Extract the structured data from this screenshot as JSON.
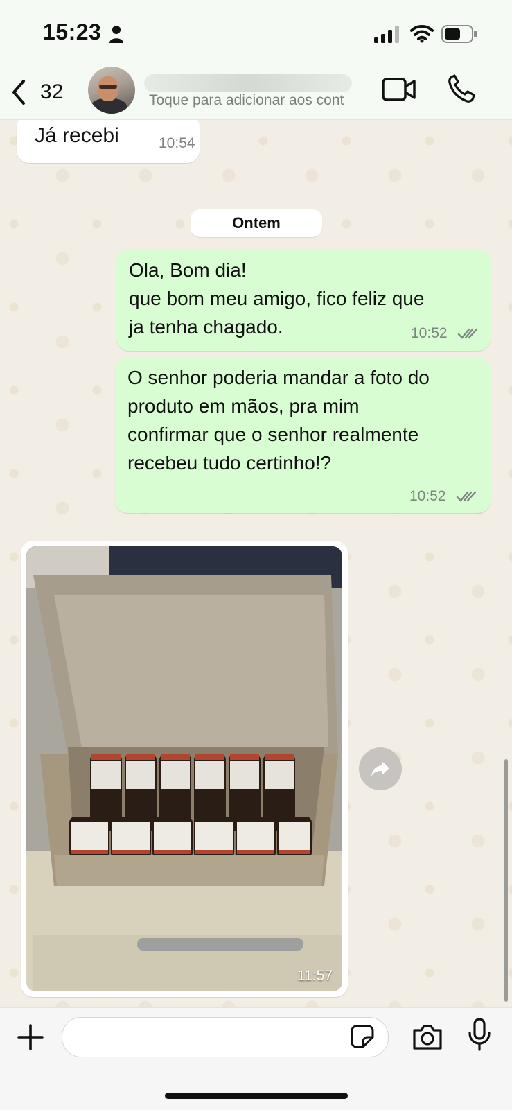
{
  "status_bar": {
    "time": "15:23",
    "icons": [
      "person-icon",
      "signal-icon",
      "wifi-icon",
      "battery-icon"
    ]
  },
  "header": {
    "back_count": "32",
    "contact_subtitle": "Toque para adicionar aos cont",
    "icons": [
      "chevron-left-icon",
      "avatar",
      "video-call-icon",
      "phone-icon"
    ]
  },
  "chat": {
    "messages": [
      {
        "direction": "in",
        "text": "Já recebi",
        "time": "10:54"
      },
      {
        "direction": "out",
        "text": "Ola, Bom dia!\nque bom meu amigo, fico feliz que\nja tenha chagado.",
        "time": "10:52",
        "status": "read"
      },
      {
        "direction": "out",
        "text": "O senhor poderia mandar a foto do\nproduto em mãos, pra mim\nconfirmar que o senhor realmente\nrecebeu tudo certinho!?",
        "time": "10:52",
        "status": "read"
      },
      {
        "direction": "in",
        "type": "image",
        "time": "11:57"
      }
    ],
    "date_separator": "Ontem"
  },
  "input_bar": {
    "placeholder": "",
    "icons": [
      "plus-icon",
      "sticker-icon",
      "camera-icon",
      "mic-icon"
    ]
  },
  "colors": {
    "outgoing_bubble": "#d9fdd3",
    "incoming_bubble": "#ffffff",
    "chat_background": "#f3eee5",
    "read_ticks": "#7d8680"
  }
}
